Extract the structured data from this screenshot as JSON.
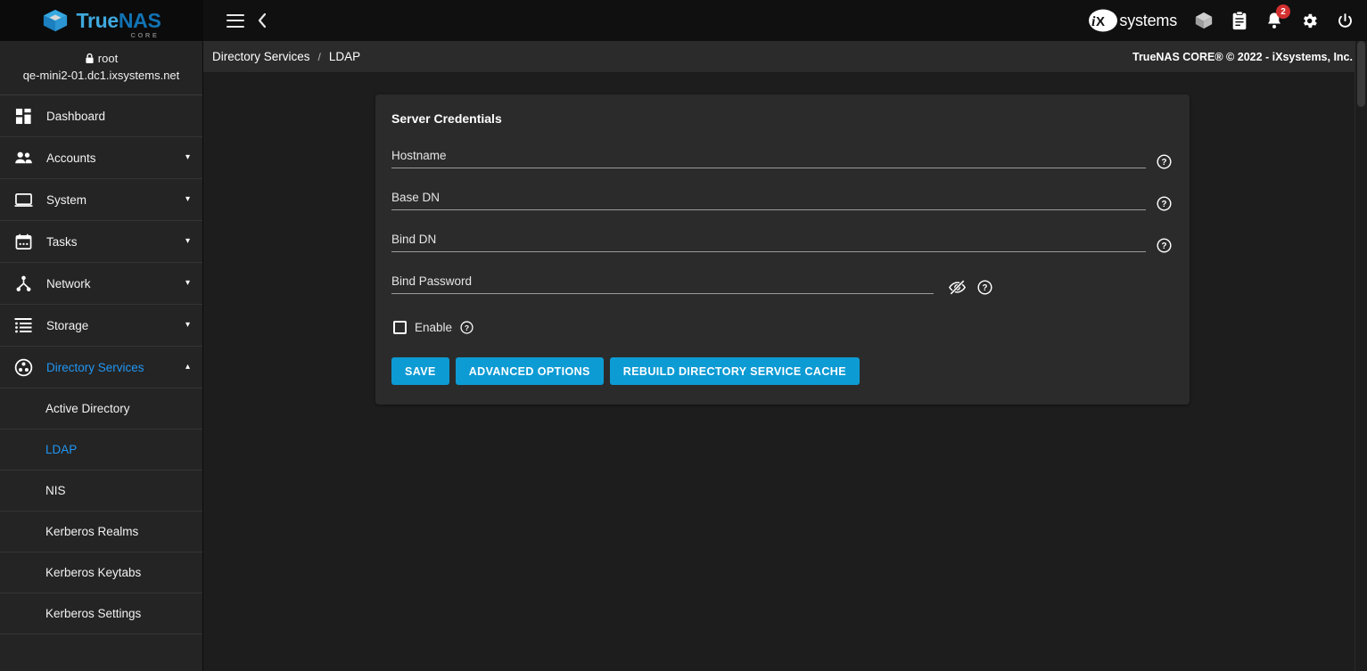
{
  "brand": {
    "logo_true": "True",
    "logo_nas": "NAS",
    "logo_sub": "CORE",
    "accent_blue": "#0d9bd4",
    "link_blue": "#2196f3",
    "badge_red": "#d32f2f"
  },
  "topbar": {
    "menu_icon": "hamburger-icon",
    "back_icon": "chevron-left-icon",
    "ix_logo_text": "systems",
    "icons": [
      {
        "name": "jails-cube-icon",
        "label": "iocage / jails"
      },
      {
        "name": "tasks-clipboard-icon",
        "label": "Tasks"
      },
      {
        "name": "notifications-bell-icon",
        "label": "Alerts"
      },
      {
        "name": "settings-gear-icon",
        "label": "Settings"
      },
      {
        "name": "power-icon",
        "label": "Power"
      }
    ],
    "notification_count": "2"
  },
  "sidebar": {
    "user": {
      "lock_icon": "lock-icon",
      "username": "root",
      "hostname": "qe-mini2-01.dc1.ixsystems.net"
    },
    "items": [
      {
        "label": "Dashboard",
        "icon": "dashboard-icon",
        "expandable": false,
        "active": false
      },
      {
        "label": "Accounts",
        "icon": "accounts-people-icon",
        "expandable": true,
        "active": false,
        "caret": "▾"
      },
      {
        "label": "System",
        "icon": "system-monitor-icon",
        "expandable": true,
        "active": false,
        "caret": "▾"
      },
      {
        "label": "Tasks",
        "icon": "tasks-calendar-icon",
        "expandable": true,
        "active": false,
        "caret": "▾"
      },
      {
        "label": "Network",
        "icon": "network-icon",
        "expandable": true,
        "active": false,
        "caret": "▾"
      },
      {
        "label": "Storage",
        "icon": "storage-list-icon",
        "expandable": true,
        "active": false,
        "caret": "▾"
      },
      {
        "label": "Directory Services",
        "icon": "directory-services-icon",
        "expandable": true,
        "active": true,
        "caret": "▴"
      }
    ],
    "subitems": [
      {
        "label": "Active Directory",
        "active": false
      },
      {
        "label": "LDAP",
        "active": true
      },
      {
        "label": "NIS",
        "active": false
      },
      {
        "label": "Kerberos Realms",
        "active": false
      },
      {
        "label": "Kerberos Keytabs",
        "active": false
      },
      {
        "label": "Kerberos Settings",
        "active": false
      }
    ]
  },
  "breadcrumb": {
    "parent": "Directory Services",
    "separator": "/",
    "current": "LDAP"
  },
  "footer": {
    "copyright": "TrueNAS CORE® © 2022 - iXsystems, Inc."
  },
  "form": {
    "title": "Server Credentials",
    "fields": [
      {
        "label": "Hostname",
        "value": "",
        "placeholder": "",
        "help_icon": "help-circle-icon"
      },
      {
        "label": "Base DN",
        "value": "",
        "placeholder": "",
        "help_icon": "help-circle-icon"
      },
      {
        "label": "Bind DN",
        "value": "",
        "placeholder": "",
        "help_icon": "help-circle-icon"
      }
    ],
    "password_field": {
      "label": "Bind Password",
      "value": "",
      "placeholder": "",
      "toggle_icon": "eye-off-icon",
      "help_icon": "help-circle-icon"
    },
    "checkbox": {
      "label": "Enable",
      "checked": false,
      "help_icon": "help-circle-icon"
    },
    "buttons": [
      {
        "label": "SAVE",
        "name": "save-button"
      },
      {
        "label": "ADVANCED OPTIONS",
        "name": "advanced-options-button"
      },
      {
        "label": "REBUILD DIRECTORY SERVICE CACHE",
        "name": "rebuild-cache-button"
      }
    ]
  }
}
